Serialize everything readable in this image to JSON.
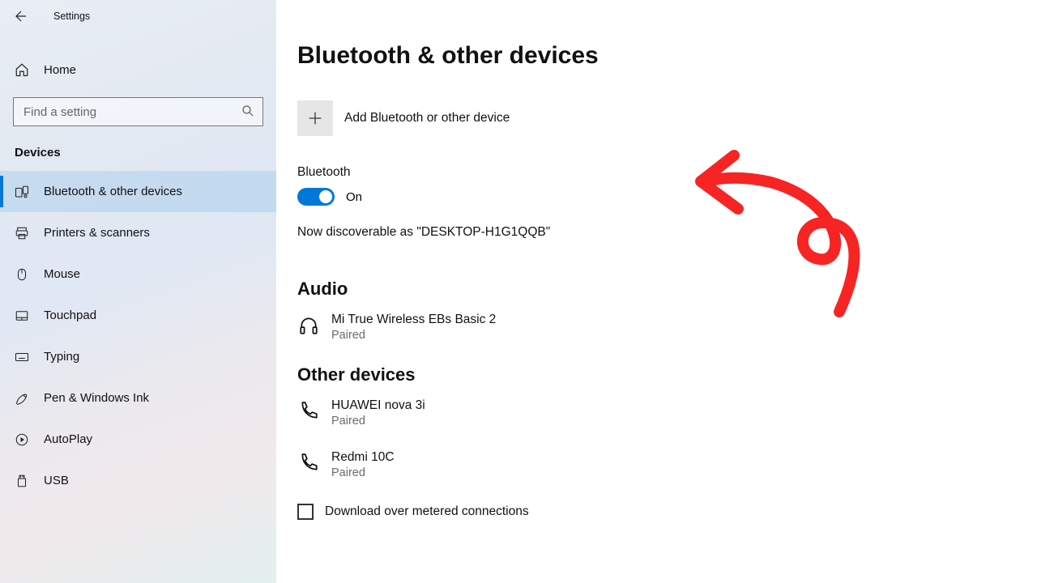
{
  "titlebar": {
    "title": "Settings"
  },
  "home": {
    "label": "Home"
  },
  "search": {
    "placeholder": "Find a setting"
  },
  "section": {
    "label": "Devices"
  },
  "nav": [
    {
      "label": "Bluetooth & other devices",
      "icon": "bluetooth-devices-icon",
      "active": true
    },
    {
      "label": "Printers & scanners",
      "icon": "printer-icon"
    },
    {
      "label": "Mouse",
      "icon": "mouse-icon"
    },
    {
      "label": "Touchpad",
      "icon": "touchpad-icon"
    },
    {
      "label": "Typing",
      "icon": "keyboard-icon"
    },
    {
      "label": "Pen & Windows Ink",
      "icon": "pen-icon"
    },
    {
      "label": "AutoPlay",
      "icon": "autoplay-icon"
    },
    {
      "label": "USB",
      "icon": "usb-icon"
    }
  ],
  "page": {
    "title": "Bluetooth & other devices",
    "add_label": "Add Bluetooth or other device",
    "bluetooth_label": "Bluetooth",
    "toggle_state": "On",
    "discoverable": "Now discoverable as \"DESKTOP-H1G1QQB\"",
    "audio_title": "Audio",
    "audio_devices": [
      {
        "name": "Mi True Wireless EBs Basic 2",
        "status": "Paired"
      }
    ],
    "other_title": "Other devices",
    "other_devices": [
      {
        "name": "HUAWEI nova 3i",
        "status": "Paired"
      },
      {
        "name": "Redmi 10C",
        "status": "Paired"
      }
    ],
    "metered_label": "Download over metered connections"
  },
  "colors": {
    "accent": "#0078d7",
    "annotation": "#f72424"
  }
}
